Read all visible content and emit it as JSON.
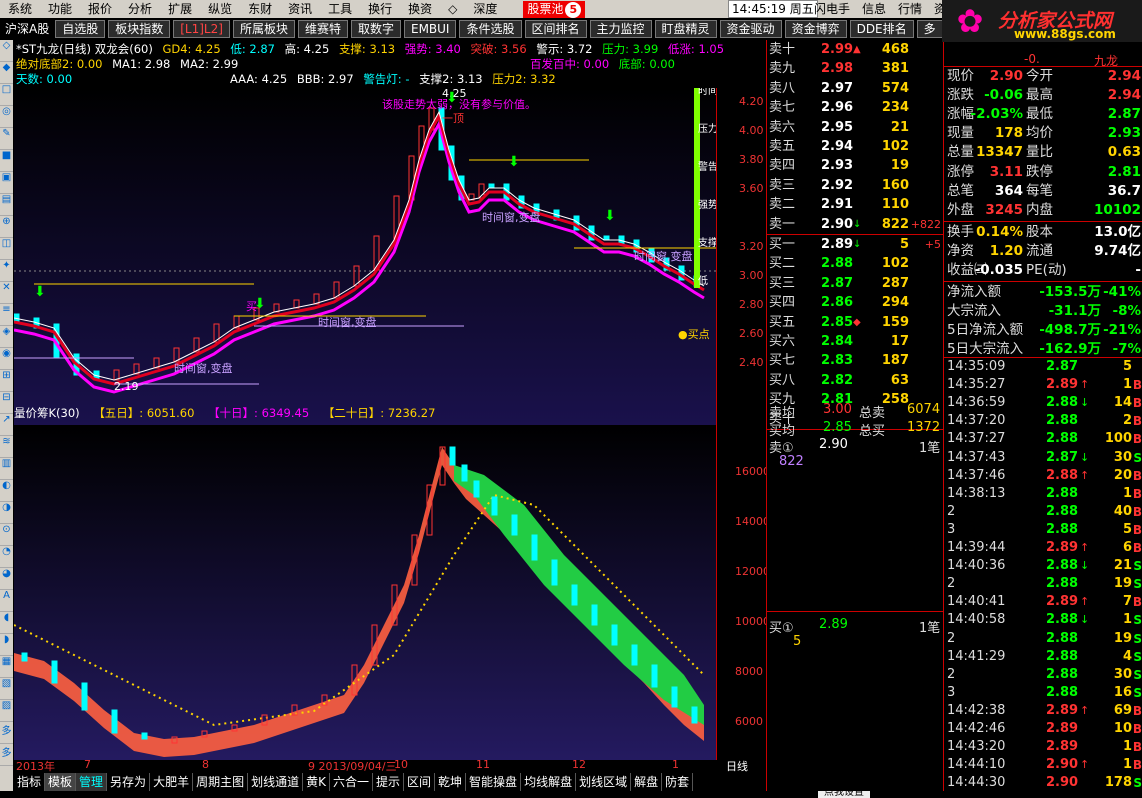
{
  "menu": {
    "items": [
      "系统",
      "功能",
      "报价",
      "分析",
      "扩展",
      "纵览",
      "东财",
      "资讯",
      "工具",
      "换行",
      "换资",
      "◇",
      "深度"
    ],
    "pool_label": "股票池",
    "pool_count": "5",
    "clock": "14:45:19 周五",
    "right_items": [
      "闪电手",
      "信息",
      "行情",
      "资"
    ]
  },
  "logo": {
    "title": "分析家公式网",
    "url": "www.88gs.com"
  },
  "toolbar": {
    "market": "沪深A股",
    "buttons": [
      "自选股",
      "板块指数",
      "[L1]L2]",
      "所属板块",
      "维赛特",
      "取数字",
      "EMBUI",
      "条件选股",
      "区间排名",
      "主力监控",
      "盯盘精灵",
      "资金驱动",
      "资金博弈",
      "DDE排名",
      "多"
    ]
  },
  "left_tools": [
    "◇",
    "◆",
    "□",
    "◎",
    "✎",
    "■",
    "▣",
    "▤",
    "⊕",
    "◫",
    "✦",
    "✕",
    "≡",
    "◈",
    "◉",
    "⊞",
    "⊟",
    "↗",
    "≋",
    "▥",
    "◐",
    "◑",
    "⊙",
    "◔",
    "◕",
    "A",
    "◖",
    "◗",
    "▦",
    "▧",
    "▨",
    "多",
    "多"
  ],
  "kline": {
    "row1": {
      "name": "*ST九龙(日线) 双龙会(60)",
      "gd4": "GD4: 4.25",
      "low": "低: 2.87",
      "high": "高: 4.25",
      "support": "支撑: 3.13",
      "strong": "强势: 3.40",
      "break": "突破: 3.56",
      "warn": "警示: 3.72",
      "pressure": "压力: 3.99",
      "lowup": "低涨: 1.05"
    },
    "row2": {
      "pos": "绝对底部2: 0.00",
      "ma1": "MA1: 2.98",
      "ma2": "MA2: 2.99",
      "b100": "百发百中: 0.00",
      "bottom": "底部: 0.00"
    },
    "row3": {
      "days": "天数: 0.00",
      "aaa": "AAA: 4.25",
      "bbb": "BBB: 2.97",
      "lamp": "警告灯: -",
      "support2": "支撑2: 3.13",
      "pressure2": "压力2: 3.32"
    },
    "ann": {
      "top_price": "4.25",
      "warning": "该股走势太弱，没有参与价值。",
      "top1": "一顶",
      "low_price": "2.19",
      "tw1": "时间窗,变盘",
      "tw2": "时间窗,变盘",
      "tw3": "时间窗,变盘",
      "tw4": "时间窗,变盘",
      "buy1": "买",
      "buypoint": "●买点",
      "price335": "3.35",
      "side": [
        "时间",
        "压力",
        "警告",
        "强势",
        "支撑",
        "低"
      ]
    },
    "yticks": [
      "4.20",
      "4.00",
      "3.80",
      "3.60",
      "3.20",
      "3.00",
      "2.80",
      "2.60",
      "2.40"
    ]
  },
  "volume": {
    "header": {
      "name": "量价筹K(30)",
      "d5": "【五日】: 6051.60",
      "d10": "【十日】: 6349.45",
      "d20": "【二十日】: 7236.27"
    },
    "yticks": [
      "16000",
      "14000",
      "12000",
      "10000",
      "8000",
      "6000"
    ]
  },
  "xaxis": {
    "labels": [
      "2013年",
      "7",
      "8",
      "9 2013/09/04/三",
      "10",
      "11",
      "12",
      "1"
    ],
    "period": "日线"
  },
  "bottom_tabs": [
    "指标",
    "模板",
    "管理",
    "另存为",
    "大肥羊",
    "周期主图",
    "划线通道",
    "黄K",
    "六合一",
    "提示",
    "区间",
    "乾坤",
    "智能操盘",
    "均线解盘",
    "划线区域",
    "解盘",
    "防套"
  ],
  "tip": "点我设置",
  "orderbook": {
    "sells": [
      {
        "label": "卖十",
        "price": "2.99",
        "arrow": "▲",
        "vol": "468"
      },
      {
        "label": "卖九",
        "price": "2.98",
        "arrow": "",
        "vol": "381"
      },
      {
        "label": "卖八",
        "price": "2.97",
        "arrow": "",
        "vol": "574"
      },
      {
        "label": "卖七",
        "price": "2.96",
        "arrow": "",
        "vol": "234"
      },
      {
        "label": "卖六",
        "price": "2.95",
        "arrow": "",
        "vol": "21"
      },
      {
        "label": "卖五",
        "price": "2.94",
        "arrow": "",
        "vol": "102"
      },
      {
        "label": "卖四",
        "price": "2.93",
        "arrow": "",
        "vol": "19"
      },
      {
        "label": "卖三",
        "price": "2.92",
        "arrow": "",
        "vol": "160"
      },
      {
        "label": "卖二",
        "price": "2.91",
        "arrow": "",
        "vol": "110"
      },
      {
        "label": "卖一",
        "price": "2.90",
        "arrow": "↓",
        "vol": "822",
        "chg": "+822"
      }
    ],
    "buys": [
      {
        "label": "买一",
        "price": "2.89",
        "arrow": "↓",
        "vol": "5",
        "chg": "+5"
      },
      {
        "label": "买二",
        "price": "2.88",
        "arrow": "",
        "vol": "102"
      },
      {
        "label": "买三",
        "price": "2.87",
        "arrow": "",
        "vol": "287"
      },
      {
        "label": "买四",
        "price": "2.86",
        "arrow": "",
        "vol": "294"
      },
      {
        "label": "买五",
        "price": "2.85",
        "arrow": "◆",
        "vol": "159"
      },
      {
        "label": "买六",
        "price": "2.84",
        "arrow": "",
        "vol": "17"
      },
      {
        "label": "买七",
        "price": "2.83",
        "arrow": "",
        "vol": "187"
      },
      {
        "label": "买八",
        "price": "2.82",
        "arrow": "",
        "vol": "63"
      },
      {
        "label": "买九",
        "price": "2.81",
        "arrow": "",
        "vol": "258"
      },
      {
        "label": "买十",
        "price": "",
        "arrow": "",
        "vol": ""
      }
    ],
    "summary": {
      "sell_avg_label": "卖均",
      "sell_avg": "3.00",
      "total_sell_label": "总卖",
      "total_sell": "6074",
      "buy_avg_label": "买均",
      "buy_avg": "2.85",
      "total_buy_label": "总买",
      "total_buy": "1372",
      "sell1_label": "卖①",
      "sell1_price": "2.90",
      "sell1_count": "1笔",
      "sell1_vol": "822",
      "buy1_label": "买①",
      "buy1_price": "2.89",
      "buy1_count": "1笔",
      "buy1_vol": "5"
    }
  },
  "top_stub": {
    "left": "-0.",
    "right": "九龙"
  },
  "stats": {
    "rows": [
      {
        "l1": "现价",
        "v1": "2.90",
        "c1": "r",
        "l2": "今开",
        "v2": "2.94",
        "c2": "r"
      },
      {
        "l1": "涨跌",
        "v1": "-0.06",
        "c1": "g",
        "l2": "最高",
        "v2": "2.94",
        "c2": "r"
      },
      {
        "l1": "涨幅",
        "v1": "-2.03%",
        "c1": "g",
        "l2": "最低",
        "v2": "2.87",
        "c2": "g"
      },
      {
        "l1": "现量",
        "v1": "178",
        "c1": "y",
        "l2": "均价",
        "v2": "2.93",
        "c2": "g"
      },
      {
        "l1": "总量",
        "v1": "13347",
        "c1": "y",
        "l2": "量比",
        "v2": "0.63",
        "c2": "y"
      },
      {
        "l1": "涨停",
        "v1": "3.11",
        "c1": "r",
        "l2": "跌停",
        "v2": "2.81",
        "c2": "g"
      },
      {
        "l1": "总笔",
        "v1": "364",
        "c1": "w",
        "l2": "每笔",
        "v2": "36.7",
        "c2": "w"
      },
      {
        "l1": "外盘",
        "v1": "3245",
        "c1": "r",
        "l2": "内盘",
        "v2": "10102",
        "c2": "g"
      }
    ],
    "rows2": [
      {
        "l1": "换手",
        "v1": "0.14%",
        "c1": "y",
        "l2": "股本",
        "v2": "13.0亿",
        "c2": "w"
      },
      {
        "l1": "净资",
        "v1": "1.20",
        "c1": "y",
        "l2": "流通",
        "v2": "9.74亿",
        "c2": "w"
      },
      {
        "l1": "收益㈢",
        "v1": "-0.035",
        "c1": "w",
        "l2": "PE(动)",
        "v2": "-",
        "c2": "w"
      }
    ],
    "flows": [
      {
        "l": "净流入额",
        "v1": "-153.5万",
        "v2": "-41%"
      },
      {
        "l": "大宗流入",
        "v1": "-31.1万",
        "v2": "-8%"
      },
      {
        "l": "5日净流入额",
        "v1": "-498.7万",
        "v2": "-21%"
      },
      {
        "l": "5日大宗流入",
        "v1": "-162.9万",
        "v2": "-7%"
      }
    ]
  },
  "trades": [
    {
      "t": "14:35:09",
      "p": "2.87",
      "c": "g",
      "a": "",
      "v": "5",
      "f": "",
      "fc": "r"
    },
    {
      "t": "14:35:27",
      "p": "2.89",
      "c": "r",
      "a": "↑",
      "v": "1",
      "f": "B",
      "fc": "r"
    },
    {
      "t": "14:36:59",
      "p": "2.88",
      "c": "g",
      "a": "↓",
      "v": "14",
      "f": "B",
      "fc": "r"
    },
    {
      "t": "14:37:20",
      "p": "2.88",
      "c": "g",
      "a": "",
      "v": "2",
      "f": "B",
      "fc": "r"
    },
    {
      "t": "14:37:27",
      "p": "2.88",
      "c": "g",
      "a": "",
      "v": "100",
      "f": "B",
      "fc": "r"
    },
    {
      "t": "14:37:43",
      "p": "2.87",
      "c": "g",
      "a": "↓",
      "v": "30",
      "f": "S",
      "fc": "g"
    },
    {
      "t": "14:37:46",
      "p": "2.88",
      "c": "r",
      "a": "↑",
      "v": "20",
      "f": "B",
      "fc": "r"
    },
    {
      "t": "14:38:13",
      "p": "2.88",
      "c": "g",
      "a": "",
      "v": "1",
      "f": "B",
      "fc": "r"
    },
    {
      "t": "2",
      "p": "2.88",
      "c": "g",
      "a": "",
      "v": "40",
      "f": "B",
      "fc": "r"
    },
    {
      "t": "3",
      "p": "2.88",
      "c": "g",
      "a": "",
      "v": "5",
      "f": "B",
      "fc": "r"
    },
    {
      "t": "14:39:44",
      "p": "2.89",
      "c": "r",
      "a": "↑",
      "v": "6",
      "f": "B",
      "fc": "r"
    },
    {
      "t": "14:40:36",
      "p": "2.88",
      "c": "g",
      "a": "↓",
      "v": "21",
      "f": "S",
      "fc": "g"
    },
    {
      "t": "2",
      "p": "2.88",
      "c": "g",
      "a": "",
      "v": "19",
      "f": "S",
      "fc": "g"
    },
    {
      "t": "14:40:41",
      "p": "2.89",
      "c": "r",
      "a": "↑",
      "v": "7",
      "f": "B",
      "fc": "r"
    },
    {
      "t": "14:40:58",
      "p": "2.88",
      "c": "g",
      "a": "↓",
      "v": "1",
      "f": "S",
      "fc": "g"
    },
    {
      "t": "2",
      "p": "2.88",
      "c": "g",
      "a": "",
      "v": "19",
      "f": "S",
      "fc": "g"
    },
    {
      "t": "14:41:29",
      "p": "2.88",
      "c": "g",
      "a": "",
      "v": "4",
      "f": "S",
      "fc": "g"
    },
    {
      "t": "2",
      "p": "2.88",
      "c": "g",
      "a": "",
      "v": "30",
      "f": "S",
      "fc": "g"
    },
    {
      "t": "3",
      "p": "2.88",
      "c": "g",
      "a": "",
      "v": "16",
      "f": "S",
      "fc": "g"
    },
    {
      "t": "14:42:38",
      "p": "2.89",
      "c": "r",
      "a": "↑",
      "v": "69",
      "f": "B",
      "fc": "r"
    },
    {
      "t": "14:42:46",
      "p": "2.89",
      "c": "r",
      "a": "",
      "v": "10",
      "f": "B",
      "fc": "r"
    },
    {
      "t": "14:43:20",
      "p": "2.89",
      "c": "r",
      "a": "",
      "v": "1",
      "f": "B",
      "fc": "r"
    },
    {
      "t": "14:44:10",
      "p": "2.90",
      "c": "r",
      "a": "↑",
      "v": "1",
      "f": "B",
      "fc": "r"
    },
    {
      "t": "14:44:30",
      "p": "2.90",
      "c": "r",
      "a": "",
      "v": "178",
      "f": "S",
      "fc": "g"
    }
  ],
  "colors": {
    "up": "#ff3333",
    "down": "#00ffff",
    "yellow": "#ffd400",
    "magenta": "#ff00ff",
    "green": "#00ff00"
  }
}
